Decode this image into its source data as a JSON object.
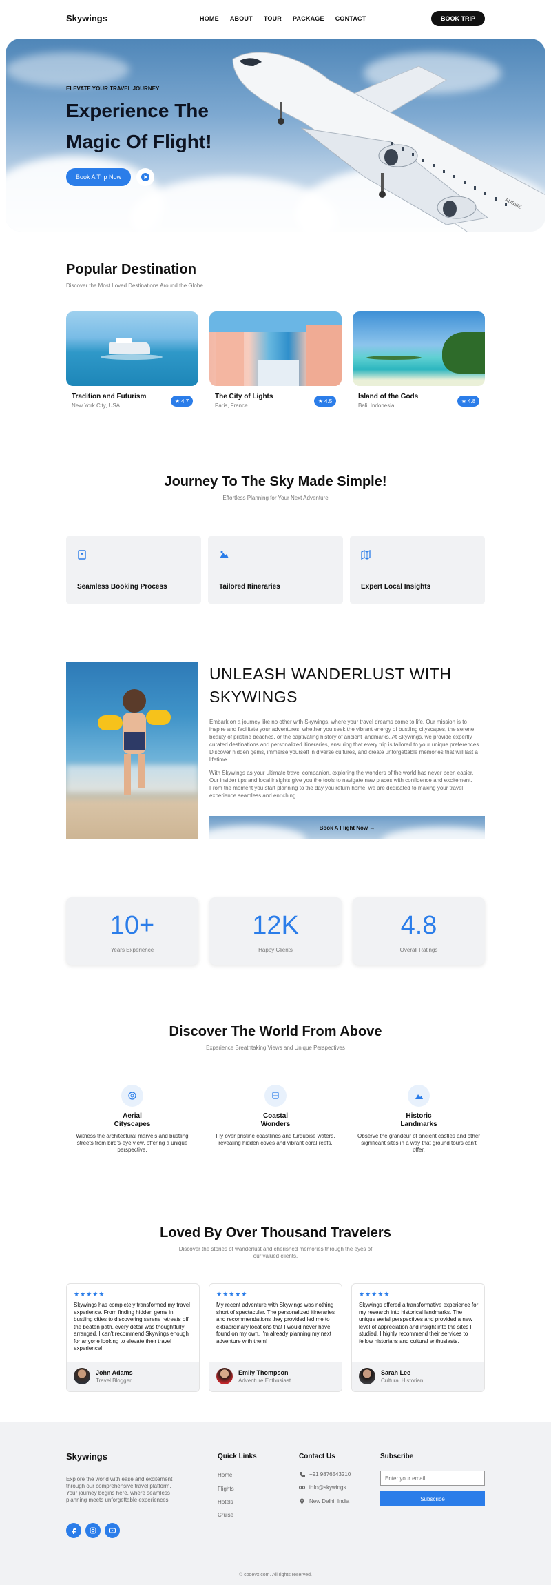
{
  "nav": {
    "logo": "Skywings",
    "items": [
      "HOME",
      "ABOUT",
      "TOUR",
      "PACKAGE",
      "CONTACT"
    ],
    "cta": "BOOK TRIP"
  },
  "hero": {
    "eyebrow": "ELEVATE YOUR TRAVEL JOURNEY",
    "title_line1": "Experience The",
    "title_line2": "Magic Of Flight!",
    "button": "Book A Trip Now",
    "plane_text": "AUSSIE"
  },
  "popular": {
    "title": "Popular Destination",
    "subtitle": "Discover the Most Loved Destinations Around the Globe",
    "cards": [
      {
        "name": "Tradition and Futurism",
        "location": "New York City, USA",
        "rating": "4.7"
      },
      {
        "name": "The City of Lights",
        "location": "Paris, France",
        "rating": "4.5"
      },
      {
        "name": "Island of the Gods",
        "location": "Bali, Indonesia",
        "rating": "4.8"
      }
    ]
  },
  "journey": {
    "title": "Journey To The Sky Made Simple!",
    "subtitle": "Effortless Planning for Your Next Adventure",
    "features": [
      {
        "label": "Seamless Booking Process",
        "icon": "bookmark-icon"
      },
      {
        "label": "Tailored Itineraries",
        "icon": "mountain-icon"
      },
      {
        "label": "Expert Local Insights",
        "icon": "map-icon"
      }
    ]
  },
  "wanderlust": {
    "title_line1": "UNLEASH WANDERLUST WITH",
    "title_line2": "SKYWINGS",
    "para1": "Embark on a journey like no other with Skywings, where your travel dreams come to life. Our mission is to inspire and facilitate your adventures, whether you seek the vibrant energy of bustling cityscapes, the serene beauty of pristine beaches, or the captivating history of ancient landmarks. At Skywings, we provide expertly curated destinations and personalized itineraries, ensuring that every trip is tailored to your unique preferences. Discover hidden gems, immerse yourself in diverse cultures, and create unforgettable memories that will last a lifetime.",
    "para2": "With Skywings as your ultimate travel companion, exploring the wonders of the world has never been easier. Our insider tips and local insights give you the tools to navigate new places with confidence and excitement. From the moment you start planning to the day you return home, we are dedicated to making your travel experience seamless and enriching.",
    "button": "Book A Flight Now →"
  },
  "stats": [
    {
      "value": "10+",
      "label": "Years Experience"
    },
    {
      "value": "12K",
      "label": "Happy Clients"
    },
    {
      "value": "4.8",
      "label": "Overall Ratings"
    }
  ],
  "discover": {
    "title": "Discover The World From Above",
    "subtitle": "Experience Breathtaking Views and Unique Perspectives",
    "items": [
      {
        "title_line1": "Aerial",
        "title_line2": "Cityscapes",
        "desc": "Witness the architectural marvels and bustling streets from bird's-eye view, offering a unique perspective.",
        "icon": "aperture-icon"
      },
      {
        "title_line1": "Coastal",
        "title_line2": "Wonders",
        "desc": "Fly over pristine coastlines and turquoise waters, revealing hidden coves and vibrant coral reefs.",
        "icon": "bus-icon"
      },
      {
        "title_line1": "Historic",
        "title_line2": "Landmarks",
        "desc": "Observe the grandeur of ancient castles and other significant sites in a way that ground tours can't offer.",
        "icon": "landmark-icon"
      }
    ]
  },
  "testimonials": {
    "title": "Loved By Over Thousand Travelers",
    "subtitle_line1": "Discover the stories of wanderlust and cherished memories through the eyes of",
    "subtitle_line2": "our valued clients.",
    "stars": "★★★★★",
    "items": [
      {
        "text": "Skywings has completely transformed my travel experience. From finding hidden gems in bustling cities to discovering serene retreats off the beaten path, every detail was thoughtfully arranged. I can't recommend Skywings enough for anyone looking to elevate their travel experience!",
        "name": "John Adams",
        "role": "Travel Blogger"
      },
      {
        "text": "My recent adventure with Skywings was nothing short of spectacular. The personalized itineraries and recommendations they provided led me to extraordinary locations that I would never have found on my own. I'm already planning my next adventure with them!",
        "name": "Emily Thompson",
        "role": "Adventure Enthusiast"
      },
      {
        "text": "Skywings offered a transformative experience for my research into historical landmarks. The unique aerial perspectives and provided a new level of appreciation and insight into the sites I studied. I highly recommend their services to fellow historians and cultural enthusiasts.",
        "name": "Sarah Lee",
        "role": "Cultural Historian"
      }
    ]
  },
  "footer": {
    "logo": "Skywings",
    "desc": "Explore the world with ease and excitement through our comprehensive travel platform. Your journey begins here, where seamless planning meets unforgettable experiences.",
    "quick_links_title": "Quick Links",
    "links": [
      "Home",
      "Flights",
      "Hotels",
      "Cruise"
    ],
    "contact_title": "Contact Us",
    "phone": "+91 9876543210",
    "email": "info@skywings",
    "address": "New Delhi, India",
    "subscribe_title": "Subscribe",
    "email_placeholder": "Enter your email",
    "subscribe_button": "Subscribe",
    "copyright": "© codevx.com. All rights reserved."
  },
  "colors": {
    "accent": "#2b7de9",
    "dark": "#111111",
    "panel": "#f1f2f4"
  }
}
